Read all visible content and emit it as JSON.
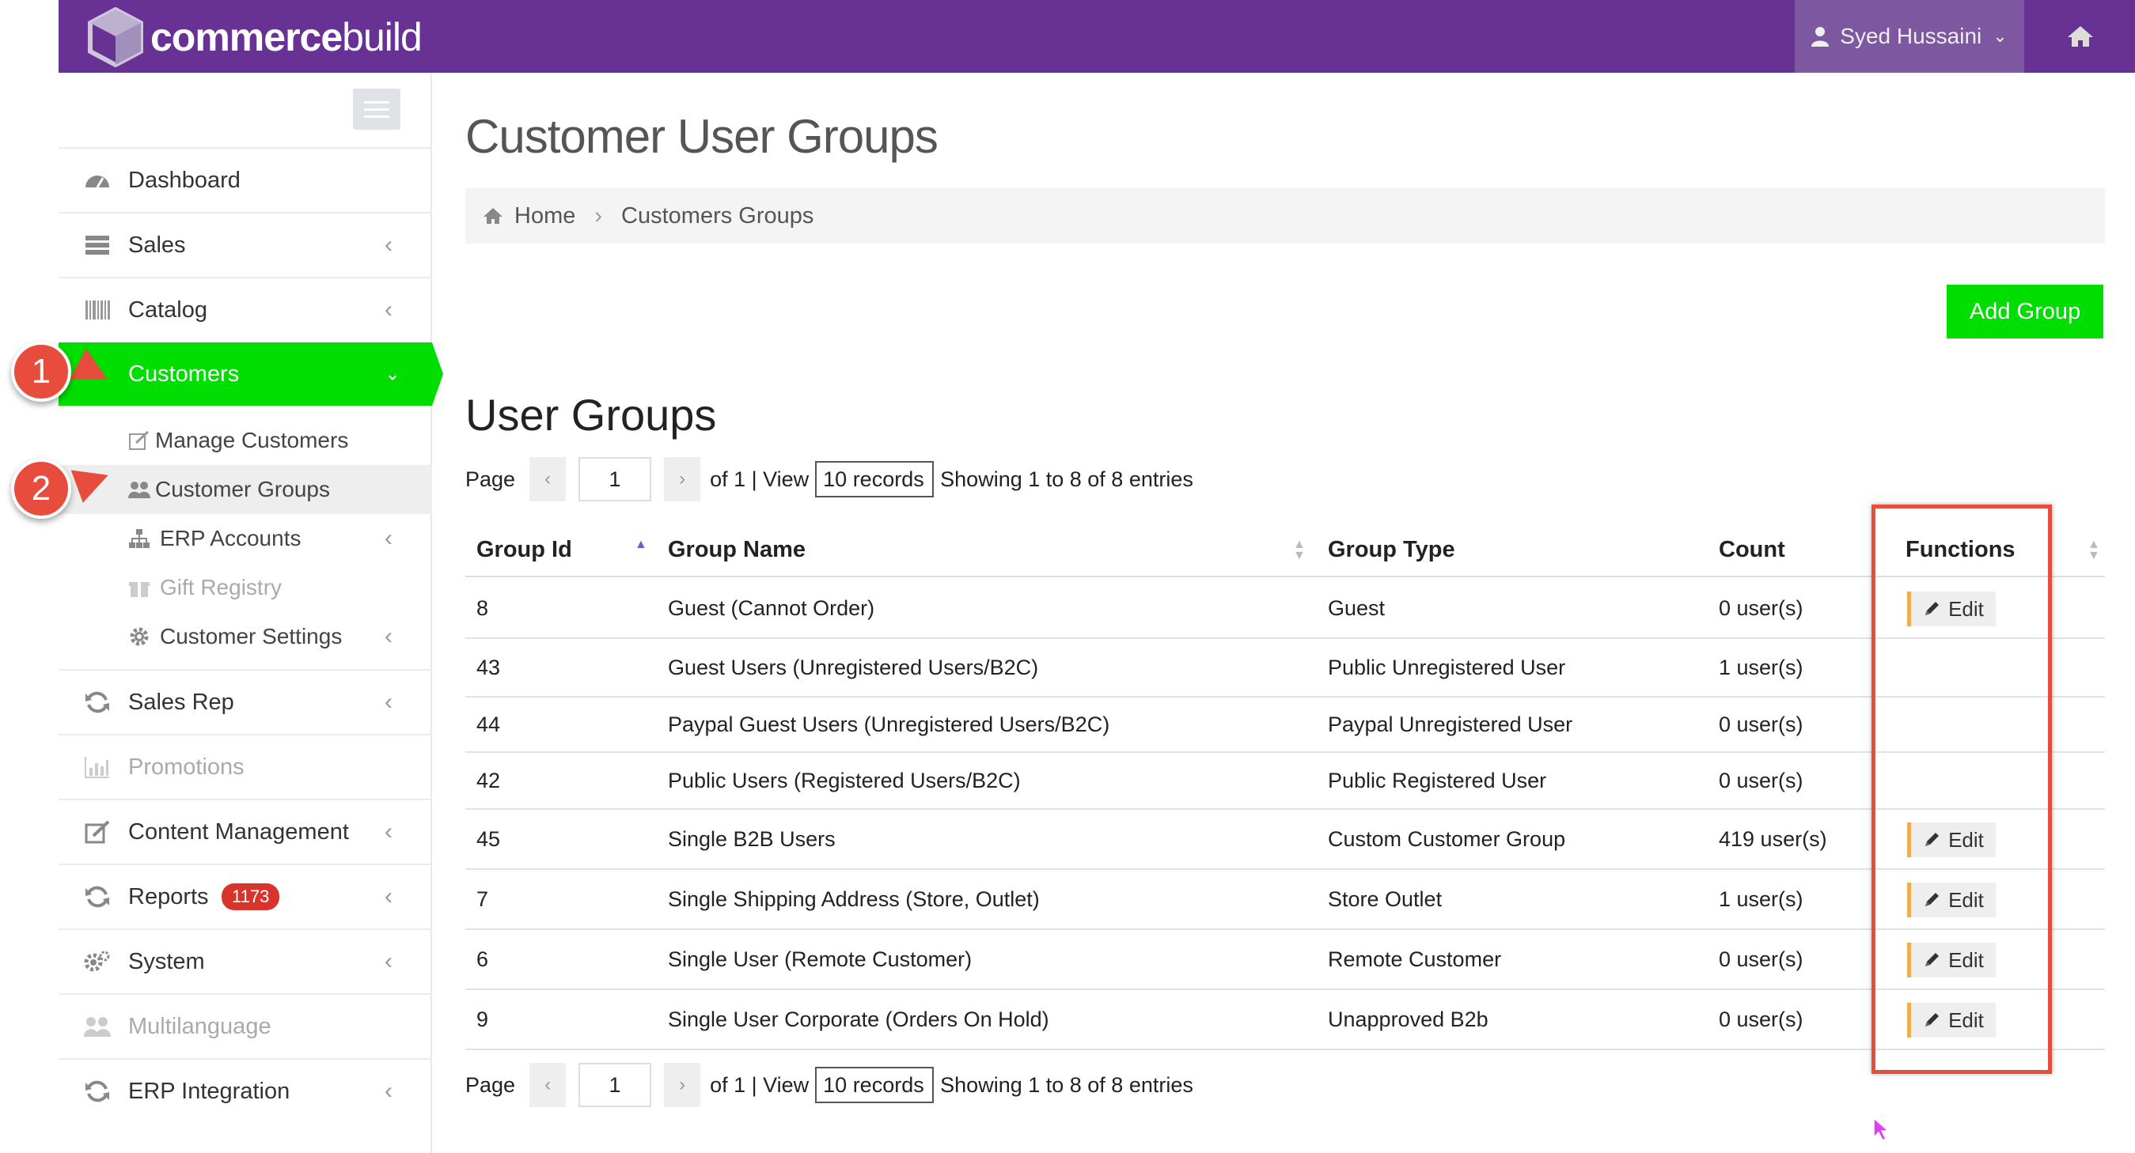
{
  "header": {
    "brand_bold": "commerce",
    "brand_light": "build",
    "user_name": "Syed Hussaini"
  },
  "sidebar": {
    "items": [
      {
        "label": "Dashboard"
      },
      {
        "label": "Sales"
      },
      {
        "label": "Catalog"
      },
      {
        "label": "Customers"
      },
      {
        "label": "Sales Rep"
      },
      {
        "label": "Promotions"
      },
      {
        "label": "Content Management"
      },
      {
        "label": "Reports",
        "badge": "1173"
      },
      {
        "label": "System"
      },
      {
        "label": "Multilanguage"
      },
      {
        "label": "ERP Integration"
      }
    ],
    "sub_items": [
      {
        "label": "Manage Customers"
      },
      {
        "label": "Customer Groups"
      },
      {
        "label": "ERP Accounts"
      },
      {
        "label": "Gift Registry"
      },
      {
        "label": "Customer Settings"
      }
    ]
  },
  "callouts": [
    "1",
    "2"
  ],
  "main": {
    "page_title": "Customer User Groups",
    "breadcrumb": [
      "Home",
      "Customers Groups"
    ],
    "add_button": "Add Group",
    "section_title": "User Groups",
    "pager": {
      "page_label": "Page",
      "page_value": "1",
      "of_label": "of 1 | View",
      "view_value": "10 records",
      "showing": "Showing 1 to 8 of 8 entries"
    },
    "table": {
      "columns": [
        "Group Id",
        "Group Name",
        "Group Type",
        "Count",
        "Functions"
      ],
      "edit_label": "Edit",
      "rows": [
        {
          "id": "8",
          "name": "Guest (Cannot Order)",
          "type": "Guest",
          "count": "0 user(s)",
          "edit": true
        },
        {
          "id": "43",
          "name": "Guest Users (Unregistered Users/B2C)",
          "type": "Public Unregistered User",
          "count": "1 user(s)",
          "edit": false
        },
        {
          "id": "44",
          "name": "Paypal Guest Users (Unregistered Users/B2C)",
          "type": "Paypal Unregistered User",
          "count": "0 user(s)",
          "edit": false
        },
        {
          "id": "42",
          "name": "Public Users (Registered Users/B2C)",
          "type": "Public Registered User",
          "count": "0 user(s)",
          "edit": false
        },
        {
          "id": "45",
          "name": "Single  B2B Users",
          "type": "Custom Customer Group",
          "count": "419 user(s)",
          "edit": true
        },
        {
          "id": "7",
          "name": "Single Shipping Address (Store, Outlet)",
          "type": "Store Outlet",
          "count": "1 user(s)",
          "edit": true
        },
        {
          "id": "6",
          "name": "Single User (Remote Customer)",
          "type": "Remote Customer",
          "count": "0 user(s)",
          "edit": true
        },
        {
          "id": "9",
          "name": "Single User Corporate (Orders On Hold)",
          "type": "Unapproved B2b",
          "count": "0 user(s)",
          "edit": true
        }
      ]
    }
  },
  "colors": {
    "topbar": "#673293",
    "active": "#00dd00",
    "callout": "#e74c3c",
    "badge": "#d9342b"
  }
}
